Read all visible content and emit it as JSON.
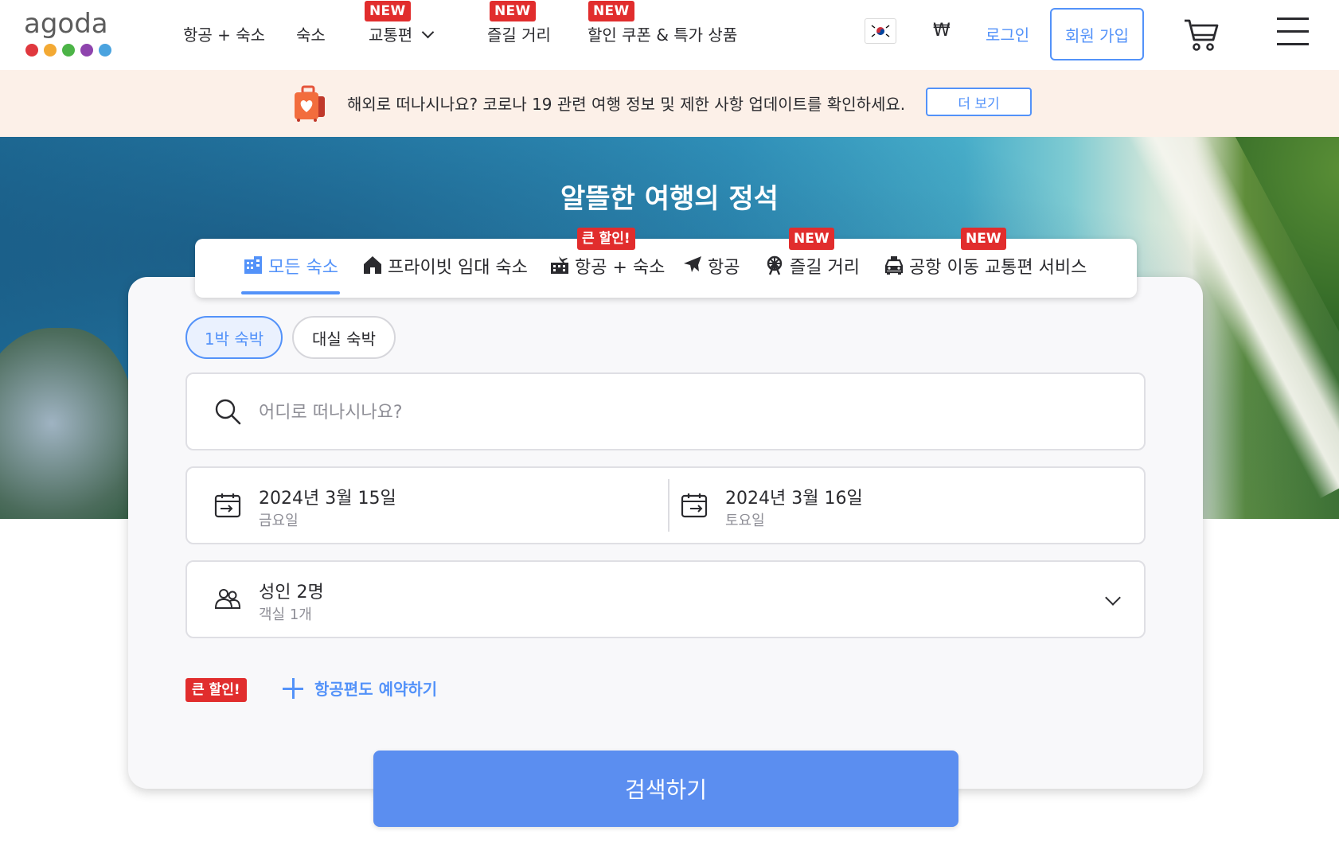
{
  "brand": {
    "name": "agoda",
    "dot_colors": [
      "#e0383e",
      "#f3a933",
      "#4cb447",
      "#8e44ad",
      "#4aa3df"
    ]
  },
  "nav": {
    "items": [
      {
        "label": "항공 + 숙소",
        "badge": ""
      },
      {
        "label": "숙소",
        "badge": ""
      },
      {
        "label": "교통편",
        "badge": "NEW"
      },
      {
        "label": "즐길 거리",
        "badge": "NEW"
      },
      {
        "label": "할인 쿠폰 & 특가 상품",
        "badge": "NEW"
      }
    ],
    "currency": "₩",
    "login": "로그인",
    "signup": "회원 가입",
    "flag_icon": "korea-flag-icon",
    "cart_icon": "cart-icon",
    "menu_icon": "hamburger-menu-icon"
  },
  "banner": {
    "text": "해외로 떠나시나요? 코로나 19 관련 여행 정보 및 제한 사항 업데이트를 확인하세요.",
    "button": "더 보기",
    "icon": "luggage-heart-icon"
  },
  "hero": {
    "title": "알뜰한 여행의 정석"
  },
  "tabs": [
    {
      "label": "모든 숙소",
      "badge": "",
      "icon": "hotel-icon",
      "active": true
    },
    {
      "label": "프라이빗 임대 숙소",
      "badge": "",
      "icon": "house-icon",
      "active": false
    },
    {
      "label": "항공 + 숙소",
      "badge": "큰 할인!",
      "icon": "flight-hotel-icon",
      "active": false
    },
    {
      "label": "항공",
      "badge": "",
      "icon": "airplane-icon",
      "active": false
    },
    {
      "label": "즐길 거리",
      "badge": "NEW",
      "icon": "ferris-wheel-icon",
      "active": false
    },
    {
      "label": "공항 이동 교통편 서비스",
      "badge": "NEW",
      "icon": "taxi-icon",
      "active": false
    }
  ],
  "search": {
    "stay_types": [
      "1박 숙박",
      "대실 숙박"
    ],
    "active_stay_type": "1박 숙박",
    "destination_placeholder": "어디로 떠나시나요?",
    "destination_value": "",
    "checkin": {
      "date": "2024년 3월 15일",
      "day": "금요일"
    },
    "checkout": {
      "date": "2024년 3월 16일",
      "day": "토요일"
    },
    "guests": {
      "main": "성인 2명",
      "sub": "객실 1개"
    },
    "deal_badge": "큰 할인!",
    "add_flight": "항공편도 예약하기",
    "submit": "검색하기"
  },
  "colors": {
    "accent": "#5392f9",
    "badge_red": "#e12d2d",
    "banner_bg": "#fcf0e8",
    "search_button": "#5b8ef0"
  }
}
